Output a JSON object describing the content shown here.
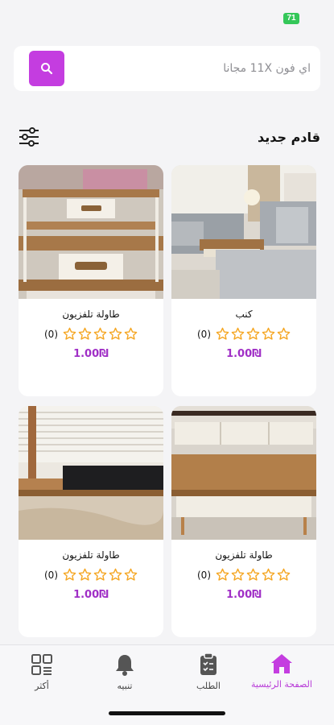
{
  "status": {
    "battery": "71"
  },
  "search": {
    "placeholder": "اي فون 11X مجانا"
  },
  "section": {
    "title": "قادم جديد"
  },
  "products": [
    {
      "name": "كنب",
      "rating_count": "(0)",
      "price": "1.00₪",
      "stars": 0
    },
    {
      "name": "طاولة تلفزيون",
      "rating_count": "(0)",
      "price": "1.00₪",
      "stars": 0
    },
    {
      "name": "طاولة تلفزيون",
      "rating_count": "(0)",
      "price": "1.00₪",
      "stars": 0
    },
    {
      "name": "طاولة تلفزيون",
      "rating_count": "(0)",
      "price": "1.00₪",
      "stars": 0
    }
  ],
  "tabs": [
    {
      "label": "الصفحة الرئيسية",
      "icon": "home-icon",
      "active": true
    },
    {
      "label": "الطلب",
      "icon": "clipboard-icon",
      "active": false
    },
    {
      "label": "تنبيه",
      "icon": "bell-icon",
      "active": false
    },
    {
      "label": "أكثر",
      "icon": "grid-icon",
      "active": false
    }
  ],
  "colors": {
    "accent": "#c43de0",
    "star": "#f5a623",
    "price": "#a02fc6"
  }
}
